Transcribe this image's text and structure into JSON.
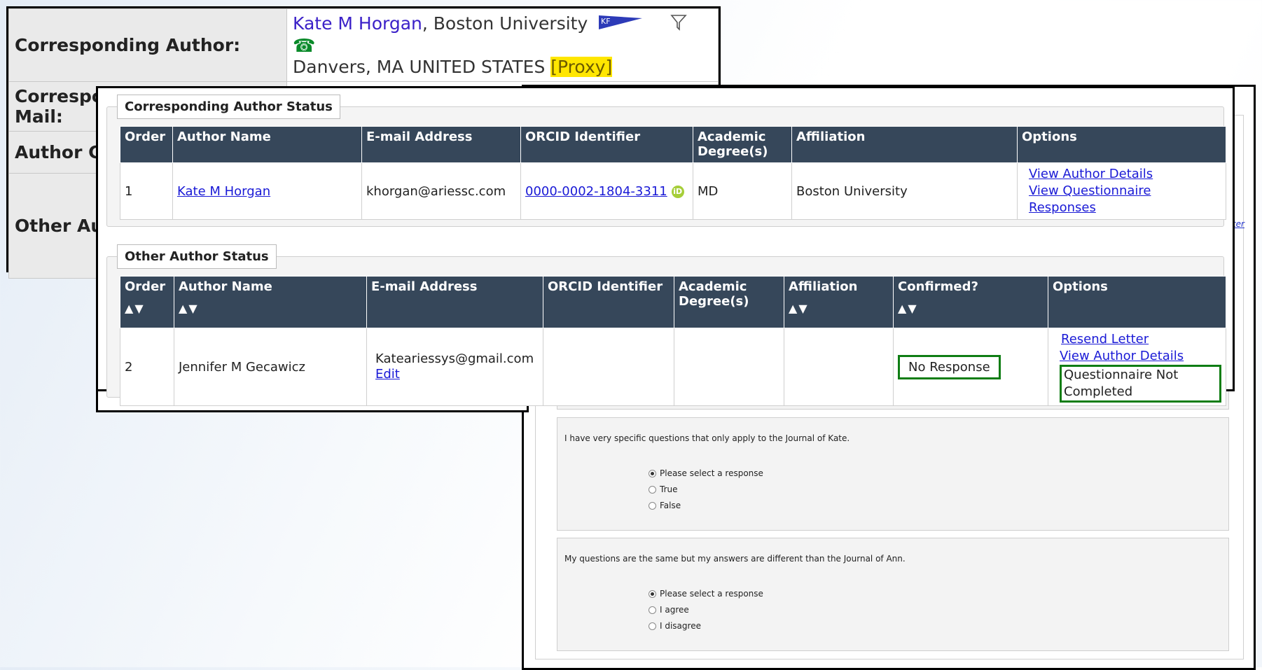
{
  "back_panel": {
    "rows": [
      {
        "label": "Corresponding Author:"
      },
      {
        "label": "Corresponding Author E-Mail:"
      },
      {
        "label": "Author Comments:"
      },
      {
        "label": "Other Authors:"
      }
    ],
    "author_name": "Kate M Horgan",
    "author_institution": ", Boston University",
    "author_location": "Danvers, MA UNITED STATES ",
    "proxy_label": "[Proxy]",
    "flag_text": "KF"
  },
  "form_window": {
    "edge_link_fragment": "tter",
    "questions": [
      {
        "text": "I have very specific questions that only apply to the Journal of Kate.",
        "options": [
          "Please select a response",
          "True",
          "False"
        ],
        "selected": 0
      },
      {
        "text": "My questions are the same but my answers are different than the Journal of Ann.",
        "options": [
          "Please select a response",
          "I agree",
          "I disagree"
        ],
        "selected": 0
      }
    ]
  },
  "front_panel": {
    "corresponding": {
      "legend": "Corresponding Author Status",
      "columns": [
        "Order",
        "Author Name",
        "E-mail Address",
        "ORCID Identifier",
        "Academic Degree(s)",
        "Affiliation",
        "Options"
      ],
      "row": {
        "order": "1",
        "name": "Kate M Horgan",
        "email": "khorgan@ariessc.com",
        "orcid": "0000-0002-1804-3311",
        "degree": "MD",
        "affiliation": "Boston University",
        "option1": "View Author Details",
        "option2": "View Questionnaire Responses"
      }
    },
    "other": {
      "legend": "Other Author Status",
      "columns": [
        "Order",
        "Author Name",
        "E-mail Address",
        "ORCID Identifier",
        "Academic Degree(s)",
        "Affiliation",
        "Confirmed?",
        "Options"
      ],
      "row": {
        "order": "2",
        "name": "Jennifer M Gecawicz",
        "email": "Kateariessys@gmail.com",
        "edit": "Edit",
        "orcid": "",
        "degree": "",
        "affiliation": "",
        "confirmed": "No Response",
        "option1": "Resend Letter",
        "option2": "View Author Details",
        "option3": "Questionnaire Not Completed"
      }
    }
  },
  "colors": {
    "header_bg": "#36475a",
    "link": "#1a1ad6",
    "highlight_box": "#0f7d14",
    "proxy_bg": "#ffe600"
  },
  "icons": [
    "flag-icon",
    "filter-icon",
    "telephone-icon",
    "orcid-icon",
    "sort-ascending-icon",
    "sort-descending-icon"
  ]
}
